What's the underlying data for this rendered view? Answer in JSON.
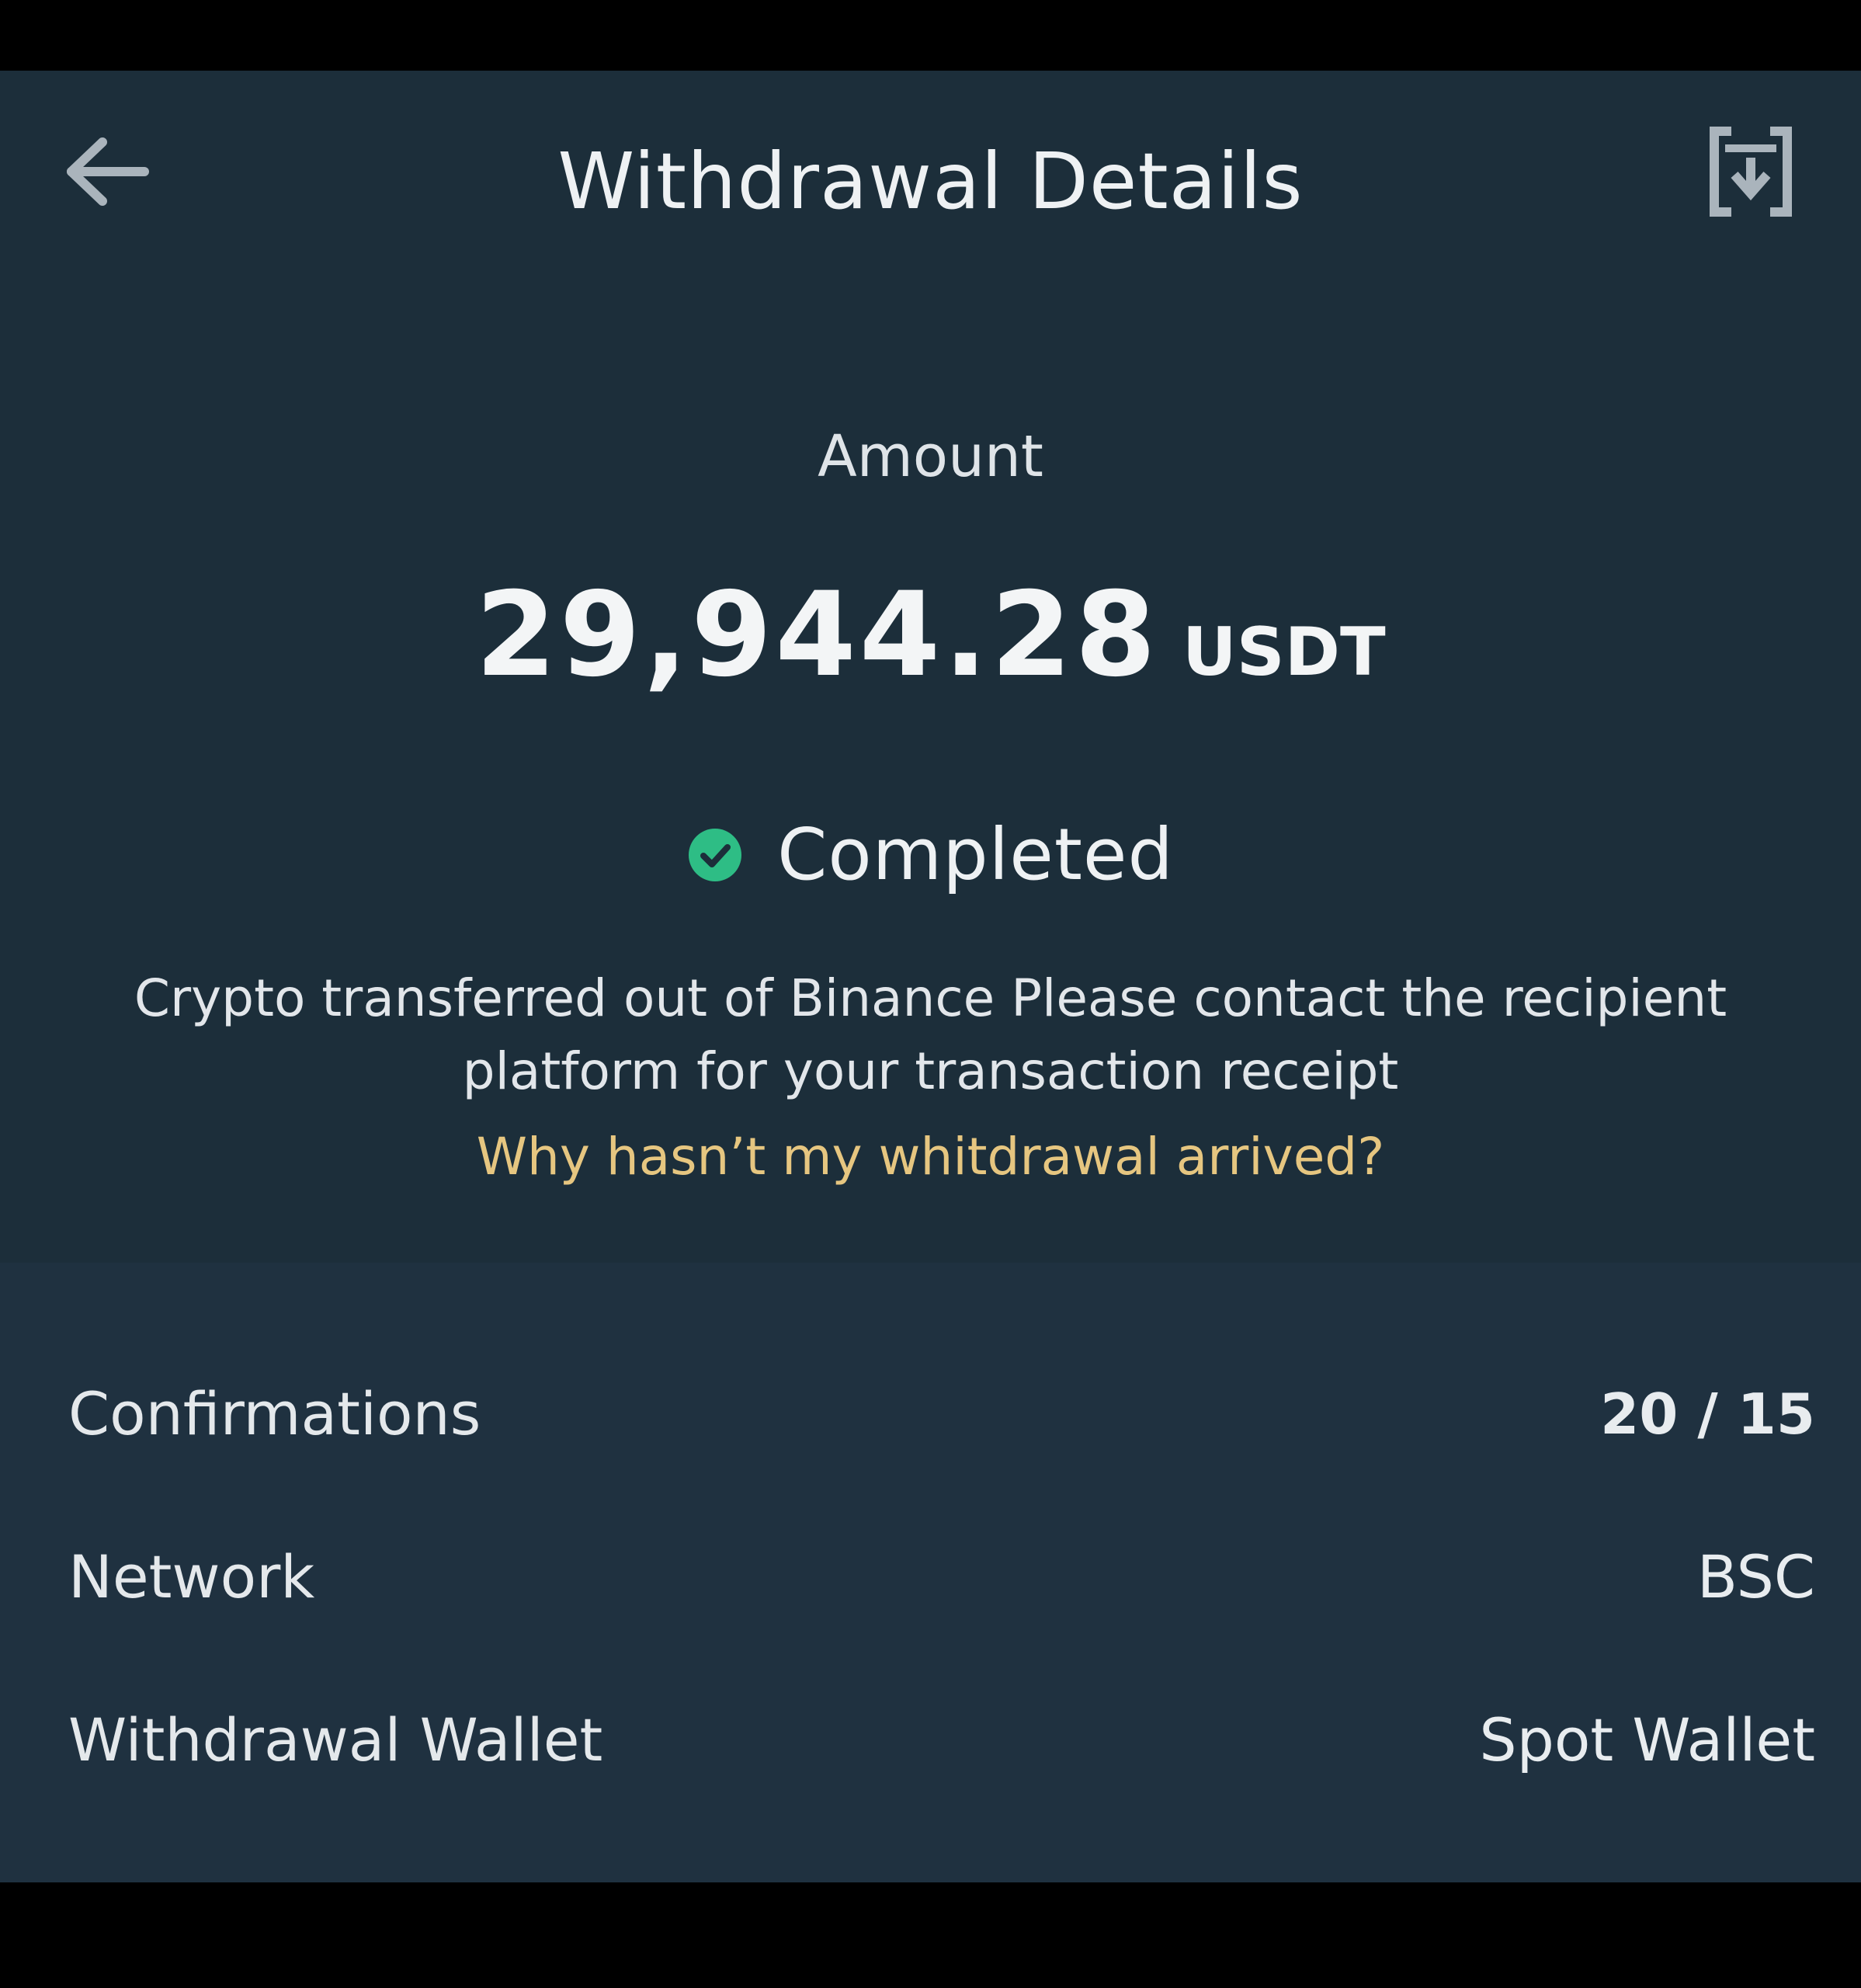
{
  "header": {
    "title": "Withdrawal Details",
    "back_icon": "arrow-left-icon",
    "download_icon": "download-icon"
  },
  "summary": {
    "amount_label": "Amount",
    "amount_value": "29,944.28",
    "amount_unit": "USDT",
    "status_icon": "check-circle-icon",
    "status_text": "Completed",
    "message": "Crypto transferred out of Binance Please contact the recipient platform for your transaction receipt",
    "help_link": "Why hasn’t my whitdrawal arrived?"
  },
  "details": [
    {
      "label": "Confirmations",
      "value": "20 / 15"
    },
    {
      "label": "Network",
      "value": "BSC"
    },
    {
      "label": "Withdrawal Wallet",
      "value": "Spot Wallet"
    }
  ],
  "colors": {
    "background": "#1c2e3a",
    "details_background": "#1f3140",
    "success": "#2ebd85",
    "link": "#e6c680",
    "text": "#eef1f3"
  }
}
